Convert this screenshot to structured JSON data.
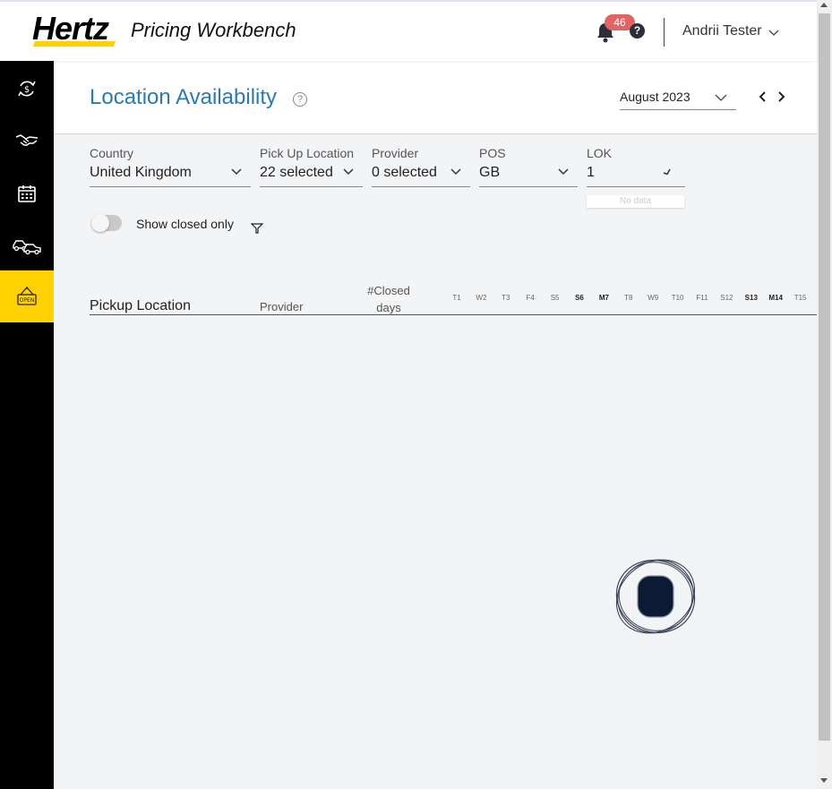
{
  "header": {
    "logo": "Hertz",
    "app_title": "Pricing Workbench",
    "notification_count": "46",
    "help": "?",
    "user_name": "Andrii Tester"
  },
  "sidebar": {
    "items": [
      {
        "icon": "currency-exchange-icon",
        "active": false
      },
      {
        "icon": "handshake-icon",
        "active": false
      },
      {
        "icon": "calendar-icon",
        "active": false
      },
      {
        "icon": "cars-icon",
        "active": false
      },
      {
        "icon": "open-sign-icon",
        "active": true,
        "text": "OPEN"
      }
    ]
  },
  "page": {
    "title": "Location Availability",
    "title_help": "?",
    "month": "August 2023"
  },
  "filters": {
    "country": {
      "label": "Country",
      "value": "United Kingdom"
    },
    "pickup": {
      "label": "Pick Up Location",
      "value": "22 selected"
    },
    "provider": {
      "label": "Provider",
      "value": "0 selected"
    },
    "pos": {
      "label": "POS",
      "value": "GB"
    },
    "lok": {
      "label": "LOK",
      "value": "1"
    },
    "lok_no_data": "No data"
  },
  "toggle": {
    "label": "Show closed only",
    "on": false
  },
  "table": {
    "headers": {
      "pickup": "Pickup Location",
      "provider": "Provider",
      "closed_line1": "#Closed",
      "closed_line2": "days"
    },
    "days": [
      {
        "label": "T1",
        "bold": false
      },
      {
        "label": "W2",
        "bold": false
      },
      {
        "label": "T3",
        "bold": false
      },
      {
        "label": "F4",
        "bold": false
      },
      {
        "label": "S5",
        "bold": false
      },
      {
        "label": "S6",
        "bold": true
      },
      {
        "label": "M7",
        "bold": true
      },
      {
        "label": "T8",
        "bold": false
      },
      {
        "label": "W9",
        "bold": false
      },
      {
        "label": "T10",
        "bold": false
      },
      {
        "label": "F11",
        "bold": false
      },
      {
        "label": "S12",
        "bold": false
      },
      {
        "label": "S13",
        "bold": true
      },
      {
        "label": "M14",
        "bold": true
      },
      {
        "label": "T15",
        "bold": false
      }
    ]
  },
  "colors": {
    "brand_yellow": "#ffd100",
    "title_blue": "#2a7ab0",
    "badge_red": "#e06666",
    "sidebar_bg": "#000000"
  }
}
